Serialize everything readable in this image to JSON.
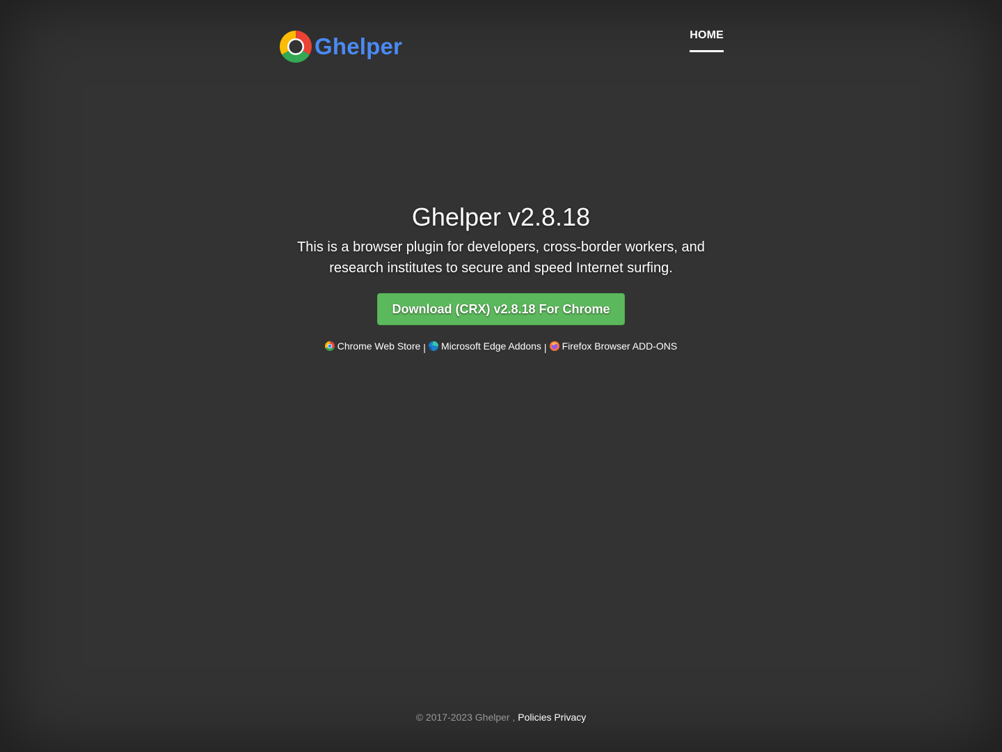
{
  "header": {
    "brand_name": "Ghelper",
    "logo_icon": "chrome-style-logo-icon",
    "nav": [
      {
        "label": "HOME",
        "active": true
      }
    ]
  },
  "hero": {
    "title": "Ghelper v2.8.18",
    "lead": "This is a browser plugin for developers, cross-border workers, and research institutes to secure and speed Internet surfing.",
    "download_button": "Download (CRX) v2.8.18 For Chrome"
  },
  "stores": [
    {
      "label": "Chrome Web Store",
      "icon": "chrome-icon"
    },
    {
      "label": "Microsoft Edge Addons",
      "icon": "edge-icon"
    },
    {
      "label": "Firefox Browser ADD-ONS",
      "icon": "firefox-icon"
    }
  ],
  "separator": "|",
  "footer": {
    "copyright": "© 2017-2023 Ghelper ,",
    "link": "Policies Privacy"
  },
  "colors": {
    "background": "#333333",
    "brand_blue": "#4a8af4",
    "button_green": "#5cb85c",
    "footer_gray": "#999999"
  }
}
